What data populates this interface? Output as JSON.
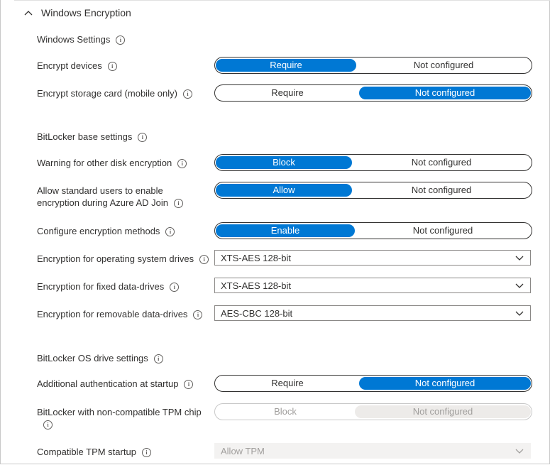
{
  "section": {
    "title": "Windows Encryption",
    "collapse_icon": "chevron-up-icon"
  },
  "windows_settings": {
    "heading": "Windows Settings",
    "encrypt_devices": {
      "label": "Encrypt devices",
      "options": [
        "Require",
        "Not configured"
      ],
      "selected": "Require"
    },
    "encrypt_storage_card": {
      "label": "Encrypt storage card (mobile only)",
      "options": [
        "Require",
        "Not configured"
      ],
      "selected": "Not configured"
    }
  },
  "bitlocker_base": {
    "heading": "BitLocker base settings",
    "warning_other_disk": {
      "label": "Warning for other disk encryption",
      "options": [
        "Block",
        "Not configured"
      ],
      "selected": "Block"
    },
    "allow_standard_users": {
      "label_line1": "Allow standard users to enable",
      "label_line2": "encryption during Azure AD Join",
      "options": [
        "Allow",
        "Not configured"
      ],
      "selected": "Allow"
    },
    "configure_methods": {
      "label": "Configure encryption methods",
      "options": [
        "Enable",
        "Not configured"
      ],
      "selected": "Enable"
    },
    "os_drives": {
      "label": "Encryption for operating system drives",
      "value": "XTS-AES 128-bit"
    },
    "fixed_drives": {
      "label": "Encryption for fixed data-drives",
      "value": "XTS-AES 128-bit"
    },
    "removable_drives": {
      "label": "Encryption for removable data-drives",
      "value": "AES-CBC 128-bit"
    }
  },
  "bitlocker_os": {
    "heading": "BitLocker OS drive settings",
    "additional_auth": {
      "label": "Additional authentication at startup",
      "options": [
        "Require",
        "Not configured"
      ],
      "selected": "Not configured"
    },
    "non_compatible_tpm": {
      "label": "BitLocker with non-compatible TPM chip",
      "options": [
        "Block",
        "Not configured"
      ],
      "selected": "Not configured",
      "disabled": true
    },
    "compatible_tpm_startup": {
      "label": "Compatible TPM startup",
      "value": "Allow TPM",
      "disabled": true
    }
  },
  "colors": {
    "accent": "#0078d4",
    "text": "#323130",
    "disabled_text": "#a19f9d"
  },
  "icons": {
    "info": "info-icon",
    "dropdown": "chevron-down-icon"
  }
}
